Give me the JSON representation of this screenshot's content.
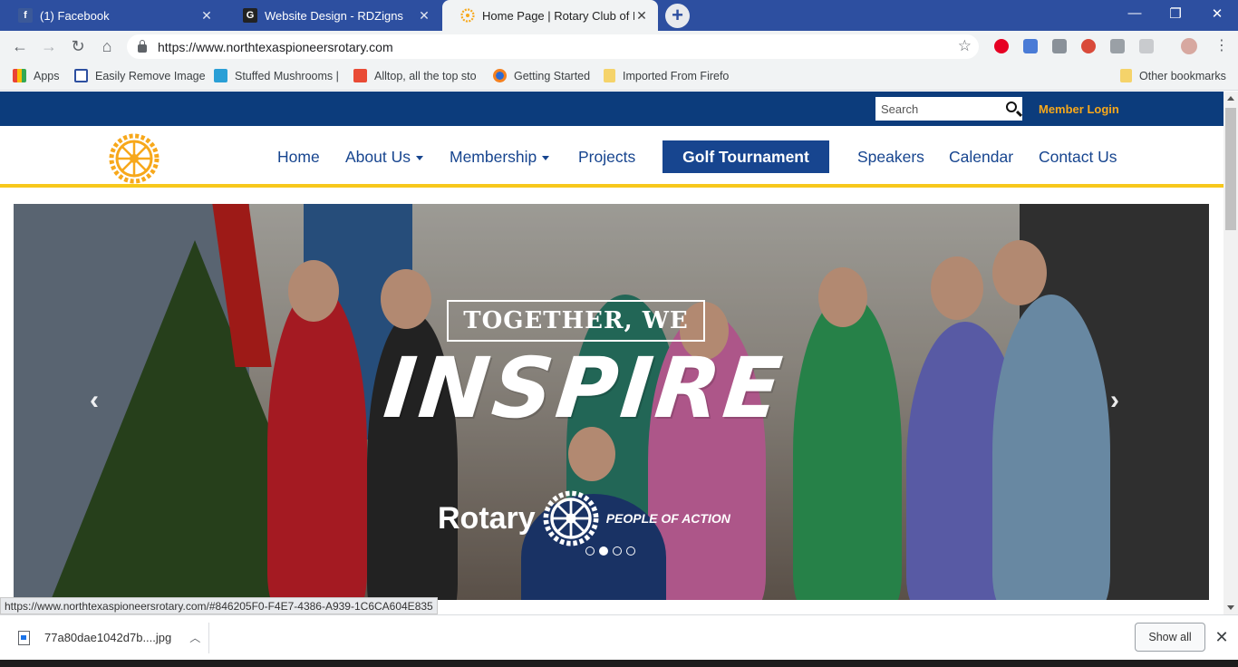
{
  "browser": {
    "tabs": [
      {
        "label": "(1) Facebook",
        "favicon": "facebook-icon",
        "active": false
      },
      {
        "label": "Website Design - RDZigns",
        "favicon": "rdzigns-icon",
        "active": false
      },
      {
        "label": "Home Page | Rotary Club of Nort",
        "favicon": "rotary-icon",
        "active": true
      }
    ],
    "newtab_symbol": "+",
    "window_controls": {
      "minimize": "—",
      "restore": "❐",
      "close": "✕"
    },
    "url": "https://www.northtexaspioneersrotary.com",
    "bookmarks": [
      {
        "label": "Apps",
        "icon": "apps-grid-icon"
      },
      {
        "label": "Easily Remove Image",
        "icon": "bookmark-page-icon"
      },
      {
        "label": "Stuffed Mushrooms |",
        "icon": "bookmark-page-icon"
      },
      {
        "label": "Alltop, all the top sto",
        "icon": "alltop-icon"
      },
      {
        "label": "Getting Started",
        "icon": "firefox-icon"
      },
      {
        "label": "Imported From Firefo",
        "icon": "folder-icon"
      }
    ],
    "other_bookmarks": "Other bookmarks"
  },
  "site": {
    "search_placeholder": "Search",
    "member_login": "Member Login",
    "nav": [
      {
        "label": "Home",
        "dropdown": false
      },
      {
        "label": "About Us",
        "dropdown": true
      },
      {
        "label": "Membership",
        "dropdown": true
      },
      {
        "label": "Projects",
        "dropdown": false
      },
      {
        "label": "Golf Tournament",
        "dropdown": false,
        "highlight": true
      },
      {
        "label": "Speakers",
        "dropdown": false
      },
      {
        "label": "Calendar",
        "dropdown": false
      },
      {
        "label": "Contact Us",
        "dropdown": false
      }
    ],
    "colors": {
      "brand_blue": "#17458f",
      "top_strip": "#0c3c7c",
      "gold": "#f7a81b",
      "accent_line": "#f7c81b"
    },
    "hero": {
      "headline_small": "TOGETHER, WE",
      "headline_big": "INSPIRE",
      "brand_word": "Rotary",
      "tagline": "PEOPLE OF ACTION",
      "slide_count": 4,
      "active_slide": 2
    }
  },
  "status_url": "https://www.northtexaspioneersrotary.com/#846205F0-F4E7-4386-A939-1C6CA604E835",
  "download": {
    "filename": "77a80dae1042d7b....jpg",
    "show_all": "Show all"
  }
}
